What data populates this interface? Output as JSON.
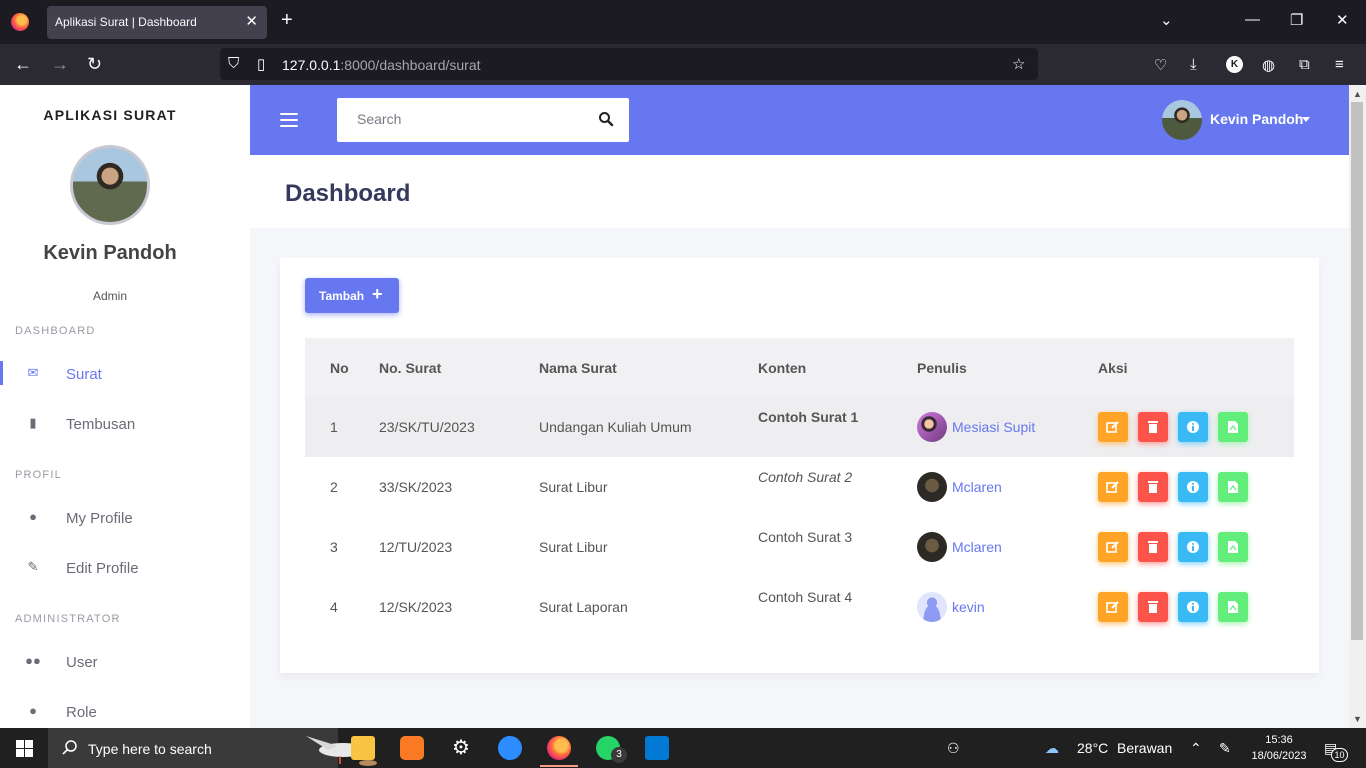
{
  "browser": {
    "tab_title": "Aplikasi Surat | Dashboard",
    "url_host": "127.0.0.1",
    "url_rest": ":8000/dashboard/surat",
    "profile_initial": "K"
  },
  "sidebar": {
    "brand": "APLIKASI SURAT",
    "user_name": "Kevin Pandoh",
    "user_role": "Admin",
    "sections": {
      "dashboard": "DASHBOARD",
      "profil": "PROFIL",
      "administrator": "ADMINISTRATOR"
    },
    "items": [
      {
        "label": "Surat",
        "icon": "envelope-icon",
        "active": true
      },
      {
        "label": "Tembusan",
        "icon": "file-icon"
      },
      {
        "label": "My Profile",
        "icon": "user-icon"
      },
      {
        "label": "Edit Profile",
        "icon": "user-edit-icon"
      },
      {
        "label": "User",
        "icon": "users-icon"
      },
      {
        "label": "Role",
        "icon": "user-tie-icon"
      }
    ]
  },
  "header": {
    "search_placeholder": "Search",
    "user_name": "Kevin Pandoh"
  },
  "page": {
    "title": "Dashboard",
    "add_button": "Tambah",
    "add_icon": "+"
  },
  "table": {
    "columns": [
      "No",
      "No. Surat",
      "Nama Surat",
      "Konten",
      "Penulis",
      "Aksi"
    ],
    "rows": [
      {
        "no": "1",
        "nomor": "23/SK/TU/2023",
        "nama": "Undangan Kuliah Umum",
        "konten": "Contoh Surat 1",
        "penulis": "Mesiasi Supit"
      },
      {
        "no": "2",
        "nomor": "33/SK/2023",
        "nama": "Surat Libur",
        "konten": "Contoh Surat 2",
        "penulis": "Mclaren"
      },
      {
        "no": "3",
        "nomor": "12/TU/2023",
        "nama": "Surat Libur",
        "konten": "Contoh Surat 3",
        "penulis": "Mclaren"
      },
      {
        "no": "4",
        "nomor": "12/SK/2023",
        "nama": "Surat Laporan",
        "konten": "Contoh Surat 4",
        "penulis": "kevin"
      }
    ]
  },
  "taskbar": {
    "search_text": "Type here to search",
    "temperature": "28°C",
    "weather": "Berawan",
    "time": "15:36",
    "date": "18/06/2023",
    "whatsapp_badge": "3",
    "notification_count": "10"
  },
  "colors": {
    "primary": "#6777ef",
    "warning": "#ffa426",
    "danger": "#fc544b",
    "info": "#3abaf4",
    "success": "#63ed7a"
  }
}
